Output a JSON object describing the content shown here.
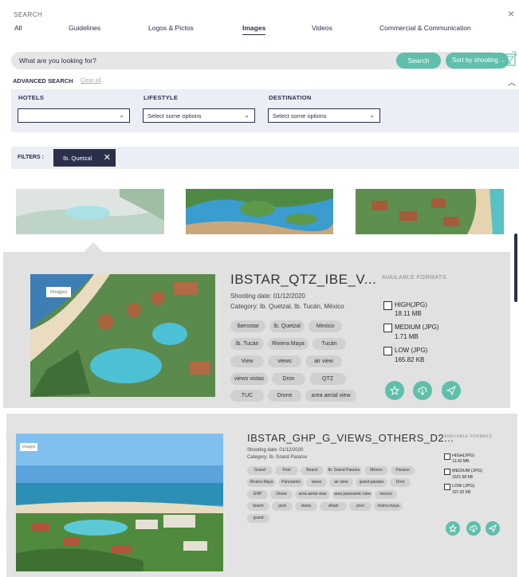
{
  "header": {
    "title": "SEARCH",
    "close": "×",
    "tabs": [
      {
        "label": "All",
        "active": false
      },
      {
        "label": "Guidelines",
        "active": false
      },
      {
        "label": "Logos & Pictos",
        "active": false
      },
      {
        "label": "Images",
        "active": true
      },
      {
        "label": "Videos",
        "active": false
      },
      {
        "label": "Commercial & Communication",
        "active": false
      }
    ]
  },
  "search": {
    "placeholder": "What are you looking for?",
    "value": "",
    "button": "Search",
    "sort": "Sort by shooting",
    "advanced": "ADVANCED SEARCH",
    "clear": "Clear all"
  },
  "advanced": {
    "hotels": {
      "label": "HOTELS",
      "value": ""
    },
    "lifestyle": {
      "label": "LIFESTYLE",
      "value": "Select some options"
    },
    "destination": {
      "label": "DESTINATION",
      "value": "Select some options"
    }
  },
  "filters": {
    "label": "FILTERS :",
    "chip": "Ib. Quetzal",
    "chip_close": "✕"
  },
  "thumbnails": [
    "aerial-resort-pool",
    "lagoon-pools-palms",
    "beach-villas-aerial"
  ],
  "detail": {
    "image_tag": "Images",
    "title": "IBSTAR_QTZ_IBE_V...",
    "shooting_date": "Shooting date: 01/12/2020",
    "category": "Category: Ib. Quetzal, Ib. Tucán, México",
    "tags": [
      "Iberostar",
      "Ib. Quetzal",
      "Mexico",
      "Ib. Tucán",
      "Riviera Maya",
      "Tucán",
      "View",
      "views",
      "air view",
      "views vistas",
      "Dron",
      "QTZ",
      "TUC",
      "Drone",
      "area aerial view"
    ],
    "formats_title": "AVAILABLE FORMATS",
    "formats": [
      {
        "name": "HIGH(JPG)",
        "size": "18.11 MB"
      },
      {
        "name": "MEDIUM (JPG)",
        "size": "1.71 MB"
      },
      {
        "name": "LOW (JPG)",
        "size": "165.82 KB"
      }
    ]
  },
  "card2": {
    "image_tag": "Images",
    "title": "IBSTAR_GHP_G_VIEWS_OTHERS_D2...",
    "shooting_date": "Shooting date: 01/12/2020",
    "category": "Category: Ib. Grand Paraíso",
    "tags": [
      "Grand",
      "Pool",
      "Beach",
      "Ib. Grand Paraíso",
      "México",
      "Paraíso",
      "Riviera Maya",
      "Panoramic",
      "views",
      "air view",
      "grand paraiso",
      "Dron",
      "GHP",
      "Drone",
      "area aerial view",
      "area panoramic view",
      "mexico",
      "beach",
      "pool",
      "views",
      "vihain",
      "pool",
      "riviera maya",
      "grand"
    ],
    "formats_title": "AVAILABLE FORMATS",
    "formats": [
      {
        "name": "HIGH(JPG)",
        "size": "13.42 MB"
      },
      {
        "name": "MEDIUM (JPG)",
        "size": "1021.58 KB"
      },
      {
        "name": "LOW (JPG)",
        "size": "107.92 KB"
      }
    ]
  },
  "colors": {
    "accent": "#5fbfaa",
    "navy": "#2b2f4a",
    "panel": "#eceef5",
    "detail_bg": "#e1e1e1"
  }
}
